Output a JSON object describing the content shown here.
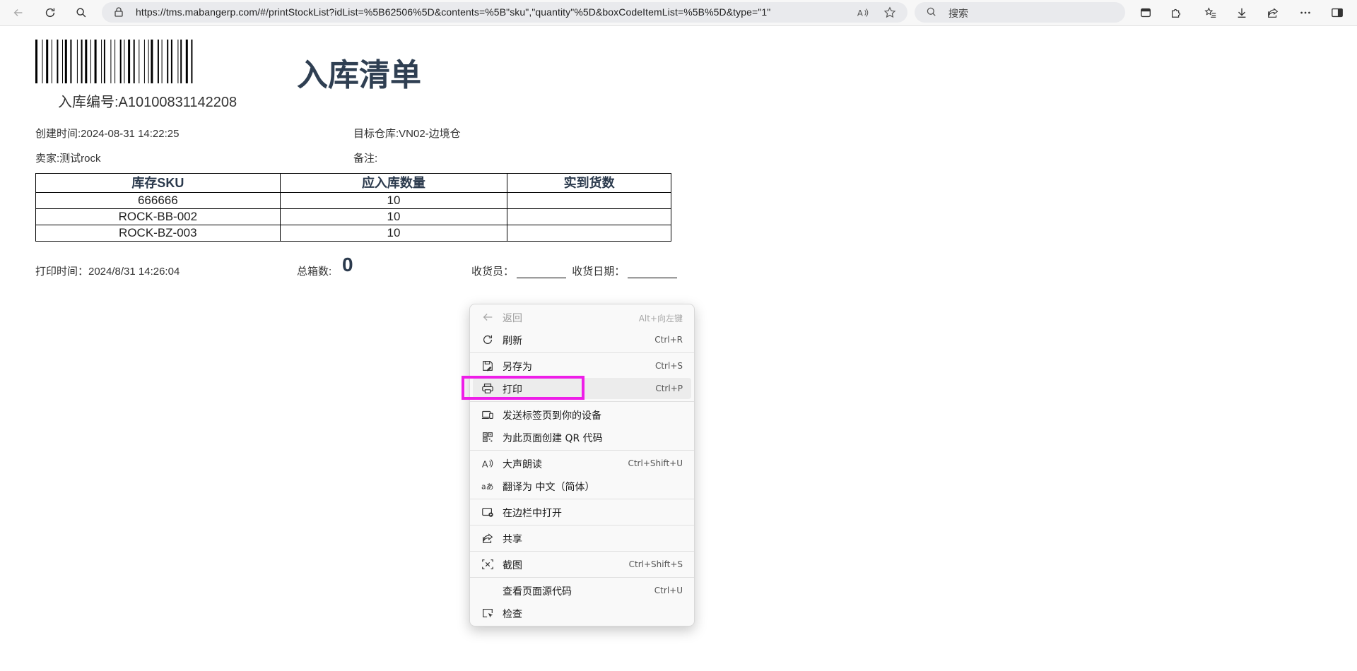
{
  "browser": {
    "url": "https://tms.mabangerp.com/#/printStockList?idList=%5B62506%5D&contents=%5B\"sku\",\"quantity\"%5D&boxCodeItemList=%5B%5D&type=\"1\"",
    "search_placeholder": "搜索"
  },
  "document": {
    "in_number": "入库编号:A10100831142208",
    "title": "入库清单",
    "created": "创建时间:2024-08-31 14:22:25",
    "target_warehouse": "目标仓库:VN02-边境仓",
    "seller": "卖家:测试rock",
    "remark": "备注:",
    "table": {
      "headers": [
        "库存SKU",
        "应入库数量",
        "实到货数"
      ],
      "rows": [
        [
          "666666",
          "10",
          ""
        ],
        [
          "ROCK-BB-002",
          "10",
          ""
        ],
        [
          "ROCK-BZ-003",
          "10",
          ""
        ]
      ]
    },
    "print_time": "打印时间：2024/8/31 14:26:04",
    "total_boxes_label": "总箱数:",
    "total_boxes_value": "0",
    "receiver_label": "收货员：",
    "receive_date_label": "收货日期："
  },
  "context_menu": {
    "items": [
      {
        "label": "返回",
        "shortcut": "Alt+向左键",
        "icon": "back-arrow-icon"
      },
      {
        "label": "刷新",
        "shortcut": "Ctrl+R",
        "icon": "refresh-icon"
      },
      {
        "label": "另存为",
        "shortcut": "Ctrl+S",
        "icon": "save-as-icon"
      },
      {
        "label": "打印",
        "shortcut": "Ctrl+P",
        "icon": "printer-icon"
      },
      {
        "label": "发送标签页到你的设备",
        "shortcut": "",
        "icon": "send-to-device-icon"
      },
      {
        "label": "为此页面创建 QR 代码",
        "shortcut": "",
        "icon": "qr-code-icon"
      },
      {
        "label": "大声朗读",
        "shortcut": "Ctrl+Shift+U",
        "icon": "read-aloud-icon"
      },
      {
        "label": "翻译为 中文（简体）",
        "shortcut": "",
        "icon": "translate-icon"
      },
      {
        "label": "在边栏中打开",
        "shortcut": "",
        "icon": "sidebar-open-icon"
      },
      {
        "label": "共享",
        "shortcut": "",
        "icon": "share-icon"
      },
      {
        "label": "截图",
        "shortcut": "Ctrl+Shift+S",
        "icon": "screenshot-icon"
      },
      {
        "label": "查看页面源代码",
        "shortcut": "Ctrl+U",
        "icon": ""
      },
      {
        "label": "检查",
        "shortcut": "",
        "icon": "inspect-icon"
      }
    ]
  },
  "colors": {
    "highlight_box": "#ee1ee8",
    "title": "#2f3f52"
  }
}
